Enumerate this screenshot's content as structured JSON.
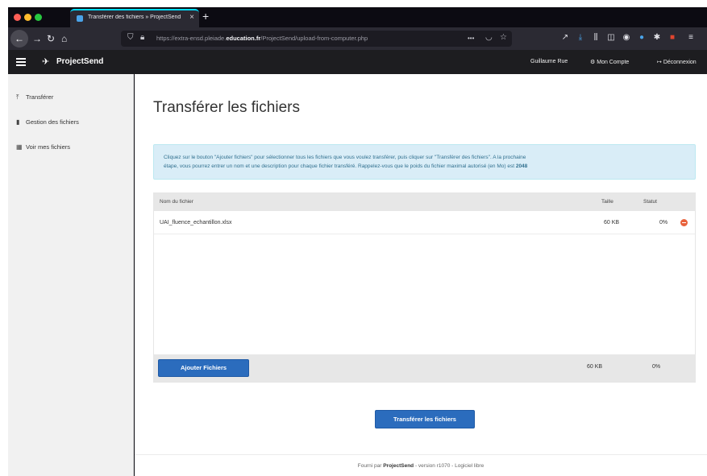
{
  "browser": {
    "tab_title": "Transférer des fichiers » ProjectSend",
    "url_prefix": "https://extra-ensd.pleiade.",
    "url_domain": "education.fr",
    "url_suffix": "/ProjectSend/upload-from-computer.php",
    "url_more": "•••"
  },
  "header": {
    "brand": "ProjectSend",
    "user": "Guillaume Rue",
    "account": "Mon Compte",
    "logout": "Déconnexion"
  },
  "sidebar": {
    "items": [
      {
        "label": "Transférer",
        "icon": "upload-icon"
      },
      {
        "label": "Gestion des fichiers",
        "icon": "file-icon"
      },
      {
        "label": "Voir mes fichiers",
        "icon": "grid-icon"
      }
    ]
  },
  "main": {
    "title": "Transférer les fichiers",
    "info_line1": "Cliquez sur le bouton \"Ajouter fichiers\" pour sélectionner tous les fichiers que vous voulez transférer, puis cliquer sur \"Transférer des fichiers\". A la prochaine",
    "info_line2": "étape, vous pourrez entrer un nom et une description pour chaque fichier transféré. Rappelez-vous que le poids du fichier maximal autorisé (en Mo) est",
    "info_max": "2048",
    "table": {
      "col_name": "Nom du fichier",
      "col_size": "Taille",
      "col_status": "Statut",
      "rows": [
        {
          "name": "UAI_fluence_echantillon.xlsx",
          "size": "60 KB",
          "status": "0%"
        }
      ]
    },
    "add_button": "Ajouter Fichiers",
    "total_size": "60 KB",
    "total_status": "0%",
    "upload_button": "Transférer les fichiers"
  },
  "footer": {
    "prefix": "Fourni par",
    "brand": "ProjectSend",
    "suffix": "- version r1070 - Logiciel libre"
  }
}
